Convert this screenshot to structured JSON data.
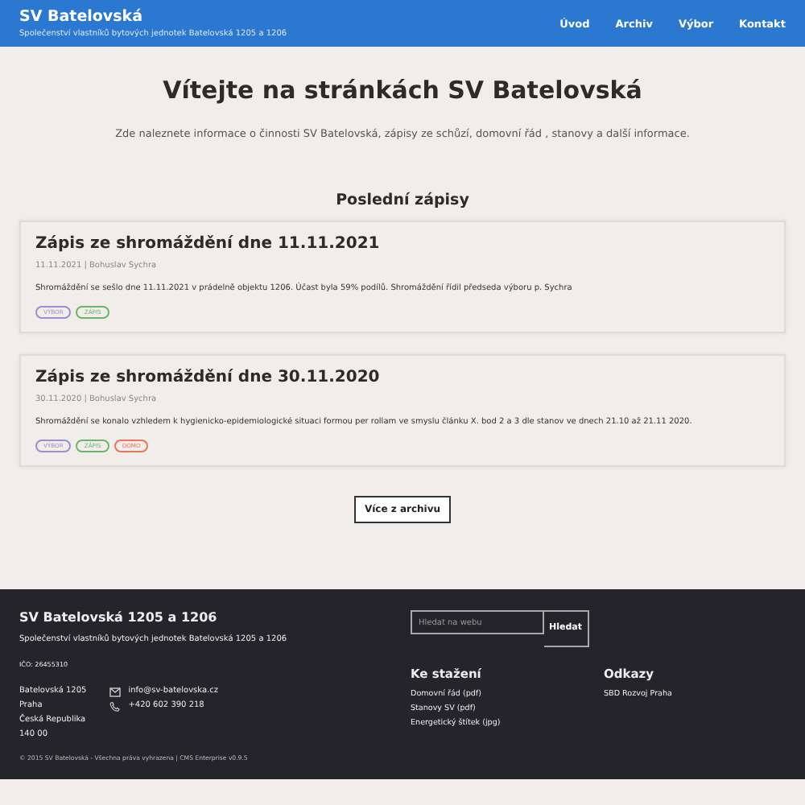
{
  "header": {
    "title": "SV Batelovská",
    "subtitle": "Společenství vlastníků bytových jednotek Batelovská 1205 a 1206",
    "nav": [
      {
        "label": "Úvod"
      },
      {
        "label": "Archiv"
      },
      {
        "label": "Výbor"
      },
      {
        "label": "Kontakt"
      }
    ]
  },
  "intro": {
    "heading": "Vítejte na stránkách SV Batelovská",
    "text": "Zde naleznete informace o činnosti SV Batelovská, zápisy ze schůzí, domovní řád , stanovy a další informace."
  },
  "section_title": "Poslední zápisy",
  "posts": [
    {
      "title": "Zápis ze shromáždění dne 11.11.2021",
      "meta": "11.11.2021 | Bohuslav Sychra",
      "text": "Shromáždění se sešlo dne 11.11.2021 v prádelně objektu 1206. Účast byla 59% podílů. Shromáždění řídil předseda výboru p. Sychra",
      "tags": [
        {
          "label": "VÝBOR",
          "color": "#9a8fd0"
        },
        {
          "label": "ZÁPIS",
          "color": "#6cb56a"
        }
      ]
    },
    {
      "title": "Zápis ze shromáždění dne 30.11.2020",
      "meta": "30.11.2020 | Bohuslav Sychra",
      "text": "Shromáždění se konalo vzhledem k hygienicko-epidemiologické situaci formou per rollam ve smyslu článku X. bod 2 a 3 dle stanov ve dnech 21.10 až 21.11 2020.",
      "tags": [
        {
          "label": "VÝBOR",
          "color": "#9a8fd0"
        },
        {
          "label": "ZÁPIS",
          "color": "#6cb56a"
        },
        {
          "label": "DOMO",
          "color": "#e8775a"
        }
      ]
    }
  ],
  "archive_button": "Více z archivu",
  "footer": {
    "title": "SV Batelovská 1205 a 1206",
    "subtitle": "Společenství vlastníků bytových jednotek Batelovská 1205 a 1206",
    "ico": "IČO: 26455310",
    "address": [
      "Batelovská 1205",
      "Praha",
      "Česká Republika",
      "140 00"
    ],
    "email": "info@sv-batelovska.cz",
    "phone": "+420 602 390 218",
    "search": {
      "placeholder": "Hledat na webu",
      "button": "Hledat"
    },
    "downloads": {
      "title": "Ke stažení",
      "links": [
        "Domovní řád (pdf)",
        "Stanovy SV (pdf)",
        "Energetický štítek (jpg)"
      ]
    },
    "links": {
      "title": "Odkazy",
      "links": [
        "SBD Rozvoj Praha"
      ]
    },
    "copyright": "© 2015 SV Batelovská  -  Všechna práva vyhrazena | CMS Enterprise v0.9.5"
  }
}
